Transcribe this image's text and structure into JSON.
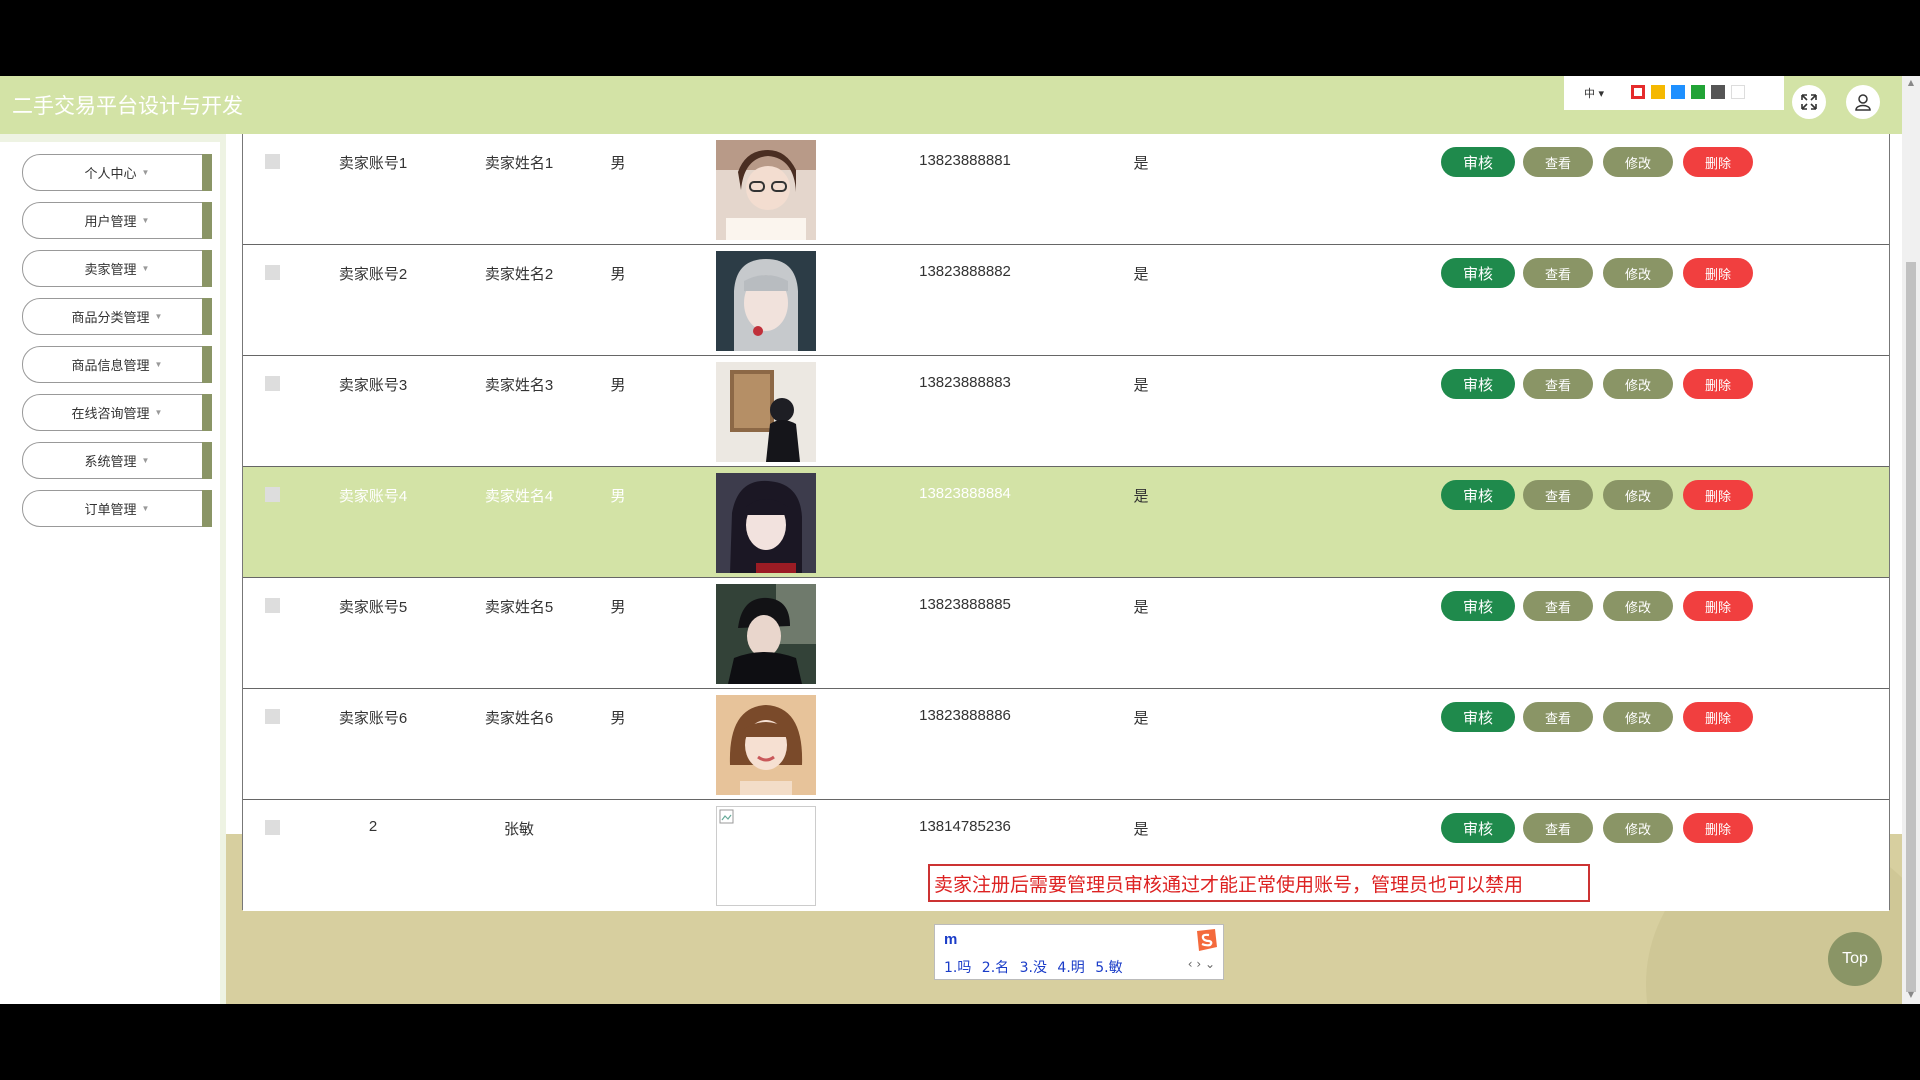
{
  "header": {
    "title": "二手交易平台设计与开发",
    "lang": "中",
    "swatches": [
      "#e52b2b",
      "#f5b800",
      "#1e90ff",
      "#21a336",
      "#555555",
      "#ffffff"
    ]
  },
  "sidebar": {
    "items": [
      {
        "label": "个人中心"
      },
      {
        "label": "用户管理"
      },
      {
        "label": "卖家管理"
      },
      {
        "label": "商品分类管理"
      },
      {
        "label": "商品信息管理"
      },
      {
        "label": "在线咨询管理"
      },
      {
        "label": "系统管理"
      },
      {
        "label": "订单管理"
      }
    ]
  },
  "table": {
    "rows": [
      {
        "account": "卖家账号1",
        "name": "卖家姓名1",
        "gender": "男",
        "phone": "13823888881",
        "audit": "是",
        "photo": "photo-1"
      },
      {
        "account": "卖家账号2",
        "name": "卖家姓名2",
        "gender": "男",
        "phone": "13823888882",
        "audit": "是",
        "photo": "photo-2"
      },
      {
        "account": "卖家账号3",
        "name": "卖家姓名3",
        "gender": "男",
        "phone": "13823888883",
        "audit": "是",
        "photo": "photo-3"
      },
      {
        "account": "卖家账号4",
        "name": "卖家姓名4",
        "gender": "男",
        "phone": "13823888884",
        "audit": "是",
        "photo": "photo-4"
      },
      {
        "account": "卖家账号5",
        "name": "卖家姓名5",
        "gender": "男",
        "phone": "13823888885",
        "audit": "是",
        "photo": "photo-5"
      },
      {
        "account": "卖家账号6",
        "name": "卖家姓名6",
        "gender": "男",
        "phone": "13823888886",
        "audit": "是",
        "photo": "photo-6"
      },
      {
        "account": "2",
        "name": "张敏",
        "gender": "",
        "phone": "13814785236",
        "audit": "是",
        "photo": "broken-image"
      }
    ],
    "buttons": {
      "audit": "审核",
      "view": "查看",
      "edit": "修改",
      "delete": "删除"
    }
  },
  "note": "卖家注册后需要管理员审核通过才能正常使用账号，管理员也可以禁用",
  "ime": {
    "input": "m",
    "candidates": "1.吗 2.名 3.没 4.明 5.敏"
  },
  "top_button": "Top",
  "colors": {
    "header": "#d3e3a6",
    "audit_btn": "#1f8a4c",
    "view_btn": "#8a9566",
    "delete_btn": "#f13f3f",
    "highlight_row": "#d3e3a6"
  }
}
